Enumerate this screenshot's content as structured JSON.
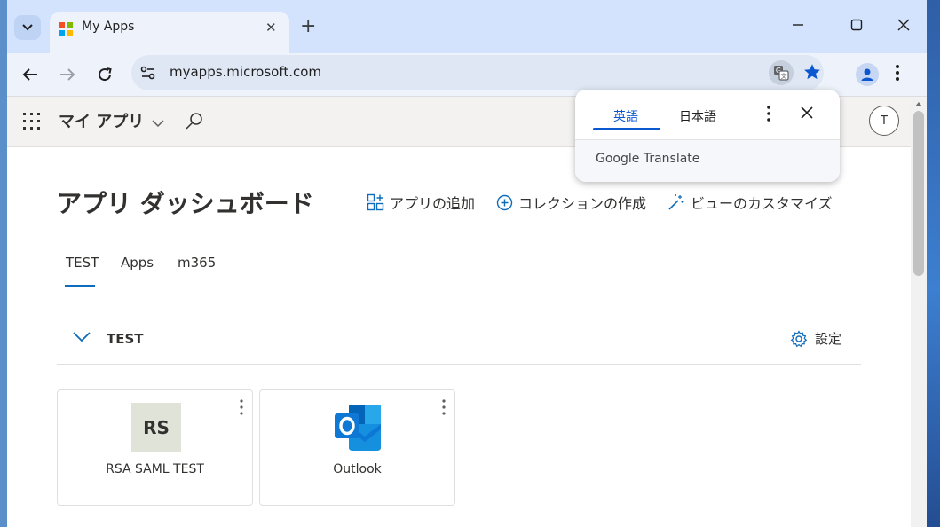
{
  "browser": {
    "tab": {
      "title": "My Apps"
    },
    "url": "myapps.microsoft.com",
    "colors": {
      "accent": "#0b57d0",
      "tabstrip": "#d3e3fd"
    }
  },
  "translate_popup": {
    "tabs": [
      {
        "label": "英語",
        "active": true
      },
      {
        "label": "日本語",
        "active": false
      }
    ],
    "brand": "Google Translate"
  },
  "app_header": {
    "name": "マイ アプリ",
    "user_initial": "T"
  },
  "dashboard": {
    "title": "アプリ ダッシュボード",
    "actions": {
      "add_app": "アプリの追加",
      "create_collection": "コレクションの作成",
      "customize_view": "ビューのカスタマイズ"
    },
    "tabs": [
      {
        "label": "TEST",
        "active": true
      },
      {
        "label": "Apps",
        "active": false
      },
      {
        "label": "m365",
        "active": false
      }
    ],
    "group": {
      "title": "TEST",
      "settings_label": "設定"
    },
    "tiles": [
      {
        "label": "RSA SAML TEST",
        "logo_text": "RS",
        "logo_color": "#dfe3d8"
      },
      {
        "label": "Outlook",
        "icon": "outlook-icon"
      }
    ]
  }
}
